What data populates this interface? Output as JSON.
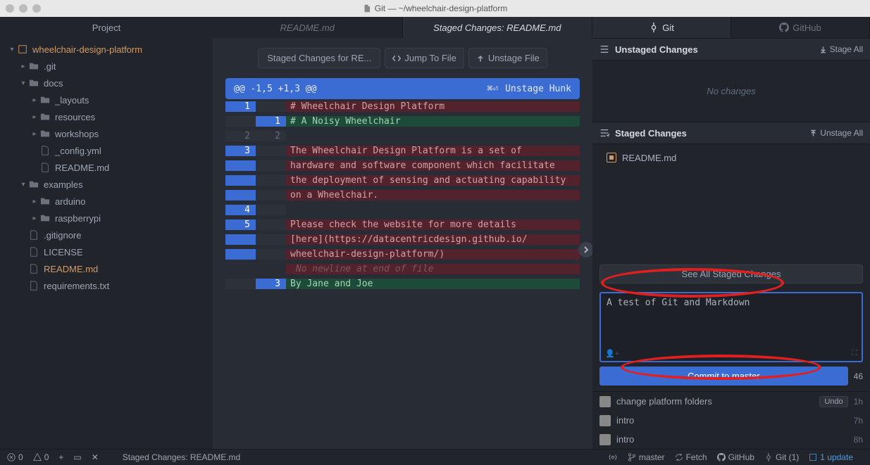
{
  "titlebar": {
    "title": "Git — ~/wheelchair-design-platform"
  },
  "project": {
    "header": "Project",
    "root": "wheelchair-design-platform",
    "tree": [
      {
        "label": ".git",
        "depth": 1,
        "type": "folder",
        "expanded": false
      },
      {
        "label": "docs",
        "depth": 1,
        "type": "folder",
        "expanded": true
      },
      {
        "label": "_layouts",
        "depth": 2,
        "type": "folder",
        "expanded": false
      },
      {
        "label": "resources",
        "depth": 2,
        "type": "folder",
        "expanded": false
      },
      {
        "label": "workshops",
        "depth": 2,
        "type": "folder",
        "expanded": false
      },
      {
        "label": "_config.yml",
        "depth": 2,
        "type": "file"
      },
      {
        "label": "README.md",
        "depth": 2,
        "type": "file"
      },
      {
        "label": "examples",
        "depth": 1,
        "type": "folder",
        "expanded": true
      },
      {
        "label": "arduino",
        "depth": 2,
        "type": "folder",
        "expanded": false
      },
      {
        "label": "raspberrypi",
        "depth": 2,
        "type": "folder",
        "expanded": false
      },
      {
        "label": ".gitignore",
        "depth": 1,
        "type": "file"
      },
      {
        "label": "LICENSE",
        "depth": 1,
        "type": "file"
      },
      {
        "label": "README.md",
        "depth": 1,
        "type": "file",
        "modified": true
      },
      {
        "label": "requirements.txt",
        "depth": 1,
        "type": "file"
      }
    ]
  },
  "tabs": [
    {
      "label": "README.md",
      "active": false
    },
    {
      "label": "Staged Changes: README.md",
      "active": true
    }
  ],
  "diff": {
    "title": "Staged Changes for RE...",
    "jump_btn": "Jump To File",
    "unstage_btn": "Unstage File",
    "hunk_range": "@@ -1,5 +1,3 @@",
    "hunk_shortcut": "⌘⏎",
    "hunk_action": "Unstage Hunk",
    "lines": [
      {
        "old": "1",
        "new": "",
        "kind": "removed",
        "text": "# Wheelchair Design Platform"
      },
      {
        "old": "",
        "new": "1",
        "kind": "added",
        "text": "# A Noisy Wheelchair"
      },
      {
        "old": "2",
        "new": "2",
        "kind": "plain",
        "text": ""
      },
      {
        "old": "3",
        "new": "",
        "kind": "removed",
        "text": "The Wheelchair Design Platform is a set of"
      },
      {
        "old": "·",
        "new": "",
        "kind": "removed",
        "text": "hardware and software component which facilitate"
      },
      {
        "old": "·",
        "new": "",
        "kind": "removed",
        "text": "the deployment of sensing and actuating capability"
      },
      {
        "old": "·",
        "new": "",
        "kind": "removed",
        "text": "on a Wheelchair."
      },
      {
        "old": "4",
        "new": "",
        "kind": "removed",
        "text": ""
      },
      {
        "old": "5",
        "new": "",
        "kind": "removed",
        "text": "Please check the website for more details"
      },
      {
        "old": "·",
        "new": "",
        "kind": "removed",
        "text": "[here](https://datacentricdesign.github.io/"
      },
      {
        "old": "·",
        "new": "",
        "kind": "removed",
        "text": "wheelchair-design-platform/)"
      },
      {
        "old": "",
        "new": "",
        "kind": "eof",
        "text": " No newline at end of file"
      },
      {
        "old": "",
        "new": "3",
        "kind": "added",
        "text": "By Jane and Joe"
      }
    ]
  },
  "right_tabs": {
    "git": "Git",
    "github": "GitHub"
  },
  "unstaged": {
    "header": "Unstaged Changes",
    "action": "Stage All",
    "empty": "No changes"
  },
  "staged": {
    "header": "Staged Changes",
    "action": "Unstage All",
    "file": "README.md"
  },
  "see_all": "See All Staged Changes",
  "commit": {
    "message": "A test of Git and Markdown",
    "button": "Commit to master",
    "count": "46"
  },
  "recent": [
    {
      "msg": "change platform folders",
      "time": "1h",
      "undo": true
    },
    {
      "msg": "intro",
      "time": "7h"
    },
    {
      "msg": "intro",
      "time": "8h"
    }
  ],
  "undo_label": "Undo",
  "statusbar": {
    "errors": "0",
    "warnings": "0",
    "file": "Staged Changes: README.md",
    "branch": "master",
    "fetch": "Fetch",
    "github": "GitHub",
    "git": "Git (1)",
    "update": "1 update"
  }
}
